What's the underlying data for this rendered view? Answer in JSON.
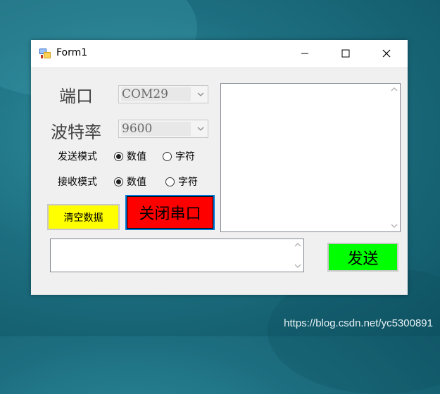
{
  "window": {
    "title": "Form1"
  },
  "port": {
    "label": "端口",
    "value": "COM29"
  },
  "baud": {
    "label": "波特率",
    "value": "9600"
  },
  "send_mode": {
    "label": "发送模式",
    "options": [
      "数值",
      "字符"
    ],
    "selected": "数值"
  },
  "recv_mode": {
    "label": "接收模式",
    "options": [
      "数值",
      "字符"
    ],
    "selected": "数值"
  },
  "buttons": {
    "clear": "清空数据",
    "close_port": "关闭串口",
    "send": "发送"
  },
  "colors": {
    "clear_bg": "#ffff00",
    "close_bg": "#ff0000",
    "send_bg": "#00ff00",
    "focus_border": "#0078d7"
  },
  "watermark": "https://blog.csdn.net/yc5300891"
}
